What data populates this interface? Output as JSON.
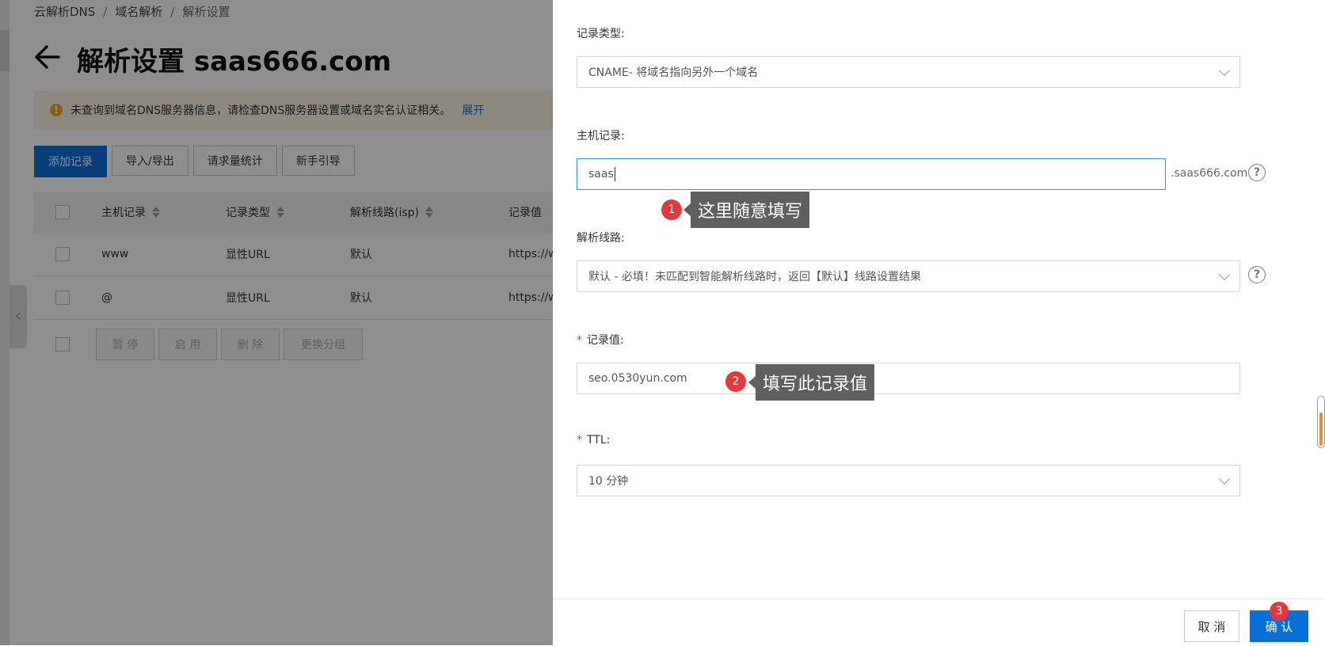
{
  "breadcrumb": [
    "云解析DNS",
    "域名解析",
    "解析设置"
  ],
  "page_title": "解析设置 saas666.com",
  "notice": {
    "message": "未查询到域名DNS服务器信息，请检查DNS服务器设置或域名实名认证相关。",
    "expand_link": "展开",
    "icon": "warning-icon"
  },
  "toolbar": {
    "add_record": "添加记录",
    "import_export": "导入/导出",
    "request_stats": "请求量统计",
    "guide": "新手引导"
  },
  "table": {
    "columns": [
      "主机记录",
      "记录类型",
      "解析线路(isp)",
      "记录值"
    ],
    "rows": [
      {
        "host": "www",
        "type": "显性URL",
        "line": "默认",
        "value": "https://w"
      },
      {
        "host": "@",
        "type": "显性URL",
        "line": "默认",
        "value": "https://w"
      }
    ]
  },
  "bulk_actions": [
    "暂 停",
    "启 用",
    "删 除",
    "更换分组"
  ],
  "form": {
    "record_type_label": "记录类型:",
    "record_type_value": "CNAME- 将域名指向另外一个域名",
    "host_label": "主机记录:",
    "host_value": "saas",
    "host_suffix": ".saas666.com",
    "line_label": "解析线路:",
    "line_value": "默认 - 必填！未匹配到智能解析线路时，返回【默认】线路设置结果",
    "value_label": "记录值:",
    "value_value": "seo.0530yun.com",
    "ttl_label": "TTL:",
    "ttl_value": "10 分钟",
    "required_mark": "*",
    "help_glyph": "?"
  },
  "annotations": [
    {
      "number": "1",
      "text": "这里随意填写"
    },
    {
      "number": "2",
      "text": "填写此记录值"
    },
    {
      "number": "3"
    }
  ],
  "footer": {
    "cancel": "取 消",
    "confirm": "确 认"
  },
  "colors": {
    "primary": "#0a6fd6",
    "annotation_red": "#e4393c",
    "tooltip_gray": "#5f5f5f",
    "notice_bg": "#fdf5e0"
  }
}
